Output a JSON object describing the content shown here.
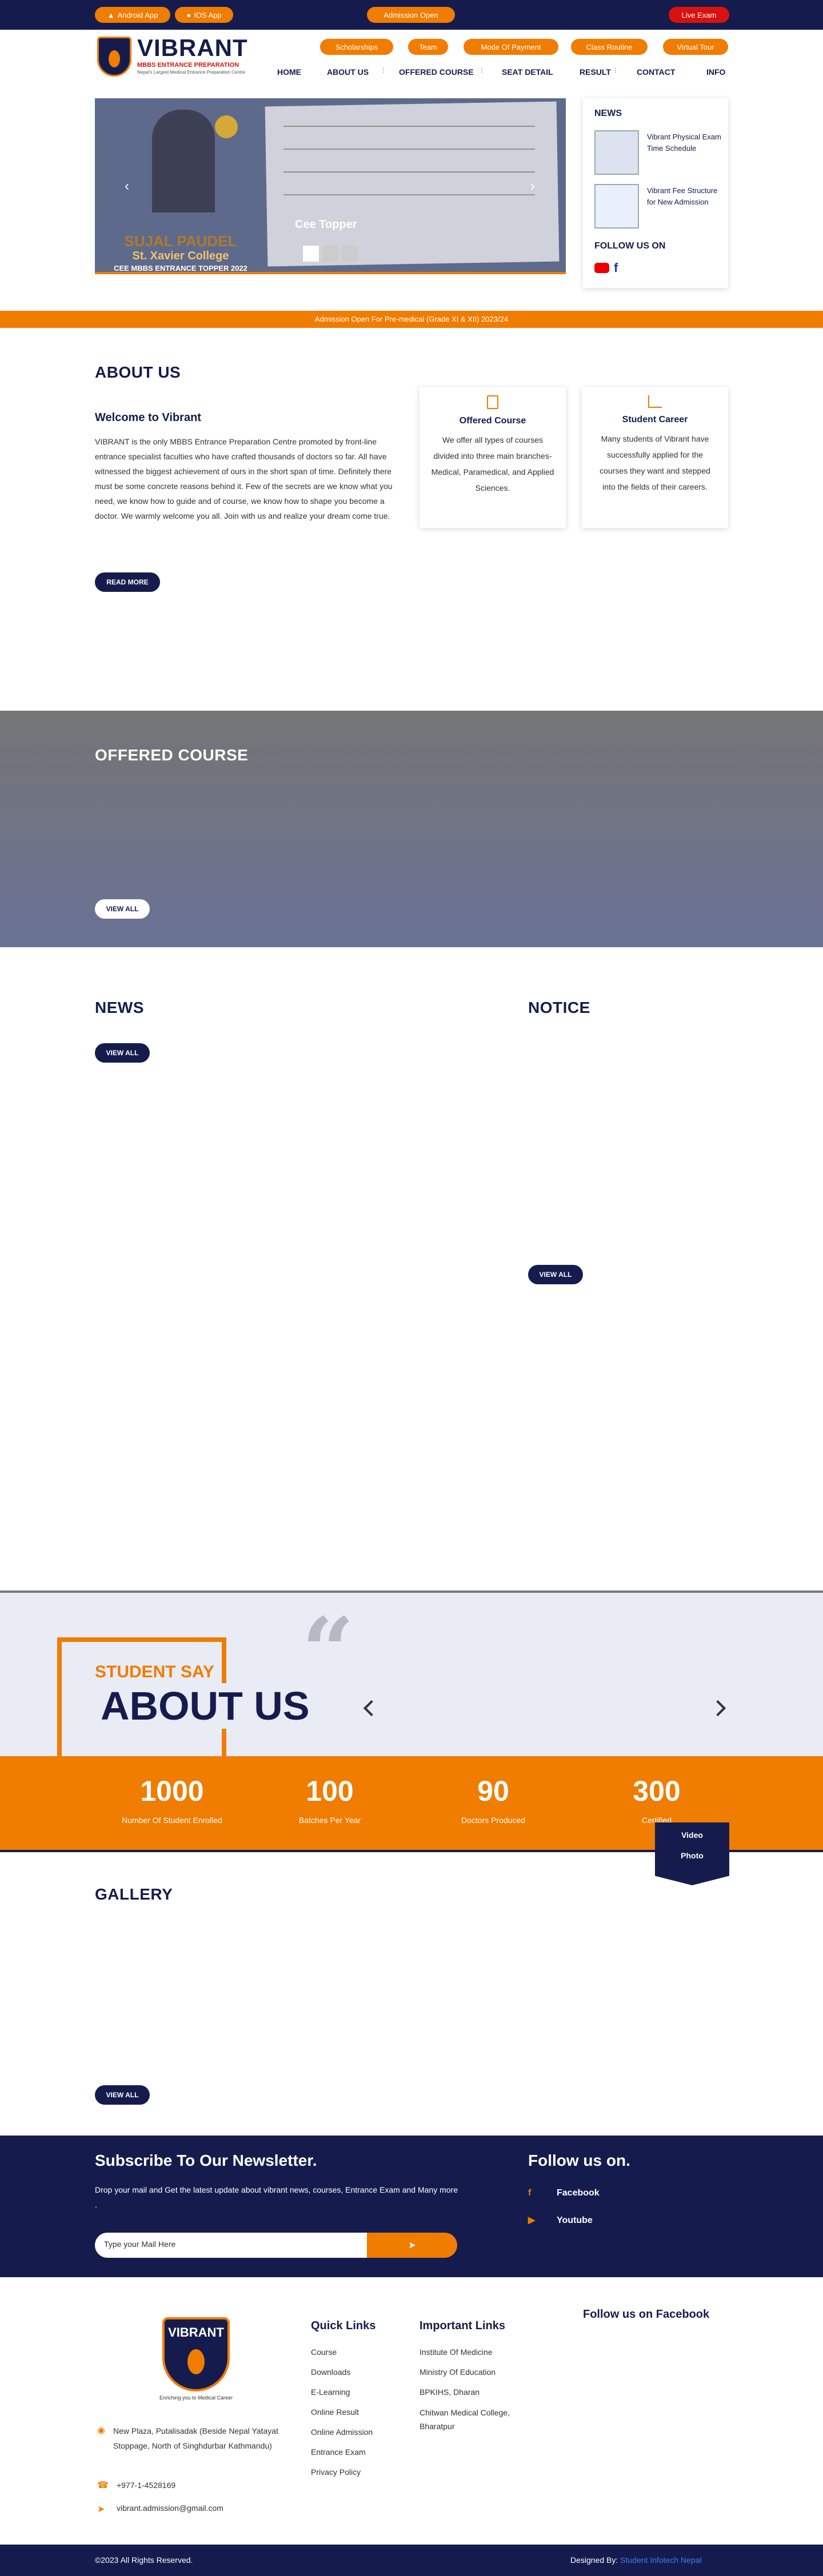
{
  "topbar": {
    "android": "Android App",
    "ios": "IOS App",
    "admission": "Admission Open",
    "live": "Live Exam"
  },
  "logo": {
    "name": "VIBRANT",
    "sub": "MBBS ENTRANCE PREPARATION",
    "tag": "Nepal's Largest Medical Entrance Preparation Centre"
  },
  "pills": [
    "Scholarships",
    "Team",
    "Mode Of Payment",
    "Class Routine",
    "Virtual Tour"
  ],
  "nav": [
    "HOME",
    "ABOUT US",
    "OFFERED COURSE",
    "SEAT DETAIL",
    "RESULT",
    "CONTACT",
    "INFO"
  ],
  "slider": {
    "name": "SUJAL PAUDEL",
    "college": "St. Xavier College",
    "rank": "CEE MBBS ENTRANCE TOPPER 2022",
    "caption": "Cee Topper"
  },
  "news_sidebar": {
    "title": "NEWS",
    "items": [
      "Vibrant Physical Exam Time Schedule",
      "Vibrant Fee Structure for New Admission"
    ],
    "follow": "FOLLOW US ON"
  },
  "ticker": "Admission Open For Pre-medical (Grade XI & XII) 2023/24",
  "about": {
    "title": "ABOUT US",
    "welcome": "Welcome to Vibrant",
    "text": "VIBRANT is the only MBBS Entrance Preparation Centre promoted by front-line entrance specialist faculties who have crafted thousands of doctors so far. All have witnessed the biggest achievement of ours in the short span of time. Definitely there must be some concrete reasons behind it. Few of the secrets are we know what you need, we know how to guide and of course, we know how to shape you become a doctor. We warmly welcome you all. Join with us and realize your dream come true.",
    "read_more": "READ MORE",
    "cards": [
      {
        "title": "Offered Course",
        "text": "We offer all types of courses divided into three main branches-Medical, Paramedical, and Applied Sciences."
      },
      {
        "title": "Student Career",
        "text": "Many students of Vibrant have successfully applied for the courses they want and stepped into the fields of their careers."
      }
    ]
  },
  "offered": {
    "title": "OFFERED COURSE",
    "view_all": "VIEW ALL"
  },
  "news": {
    "title": "NEWS",
    "view_all": "VIEW ALL"
  },
  "notice": {
    "title": "NOTICE",
    "view_all": "VIEW ALL"
  },
  "testimonial": {
    "label": "STUDENT SAY",
    "title": "ABOUT US"
  },
  "stats": [
    {
      "value": "1000",
      "label": "Number Of Student Enrolled"
    },
    {
      "value": "100",
      "label": "Batches Per Year"
    },
    {
      "value": "90",
      "label": "Doctors Produced"
    },
    {
      "value": "300",
      "label": "Certified"
    }
  ],
  "media_tabs": [
    "Video",
    "Photo"
  ],
  "gallery": {
    "title": "GALLERY",
    "view_all": "VIEW ALL"
  },
  "newsletter": {
    "title": "Subscribe To Our Newsletter.",
    "text": "Drop your mail and Get the latest update about vibrant news, courses, Entrance Exam and Many more .",
    "placeholder": "Type your Mail Here",
    "follow": "Follow us on.",
    "facebook": "Facebook",
    "youtube": "Youtube"
  },
  "footer": {
    "address": "New Plaza, Putalisadak (Beside Nepal Yatayat Stoppage, North of Singhdurbar Kathmandu)",
    "phone": "+977-1-4528169",
    "email": "vibrant.admission@gmail.com",
    "logo_tag": "Enriching you to Medical Career",
    "quick_title": "Quick Links",
    "quick": [
      "Course",
      "Downloads",
      "E-Learning",
      "Online Result",
      "Online Admission",
      "Entrance Exam",
      "Privacy Policy"
    ],
    "important_title": "Important Links",
    "important": [
      "Institute Of Medicine",
      "Ministry Of Education",
      "BPKIHS, Dharan",
      "Chitwan Medical College, Bharatpur"
    ],
    "fb_title": "Follow us on Facebook",
    "copyright": "©2023 All Rights Reserved.",
    "designed_prefix": "Designed By:",
    "designed_by": "Student Infotech Nepal"
  },
  "colors": {
    "navy": "#151c4d",
    "orange": "#f07c00"
  }
}
